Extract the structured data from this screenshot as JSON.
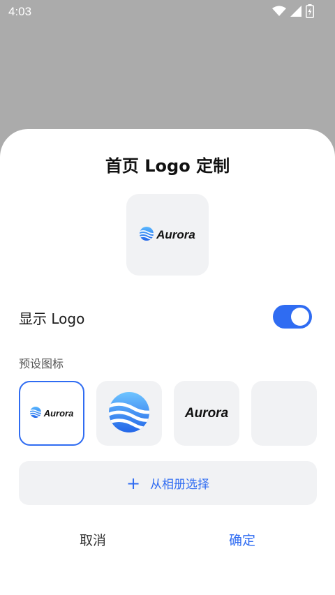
{
  "status_bar": {
    "time": "4:03",
    "icons": [
      "wifi-icon",
      "signal-icon",
      "battery-charging-icon"
    ]
  },
  "dialog": {
    "title": "首页 Logo 定制",
    "preview_brand": "Aurora",
    "show_logo_label": "显示 Logo",
    "show_logo_enabled": true,
    "presets_label": "预设图标",
    "presets": [
      {
        "kind": "logo-with-wordmark",
        "text": "Aurora",
        "selected": true
      },
      {
        "kind": "logo-mark",
        "text": "",
        "selected": false
      },
      {
        "kind": "wordmark",
        "text": "Aurora",
        "selected": false
      },
      {
        "kind": "empty",
        "text": "",
        "selected": false
      }
    ],
    "album_button_label": "从相册选择",
    "cancel_label": "取消",
    "confirm_label": "确定"
  },
  "colors": {
    "accent": "#2f6cf2",
    "overlay": "#ababab",
    "tile_bg": "#f1f2f4"
  }
}
